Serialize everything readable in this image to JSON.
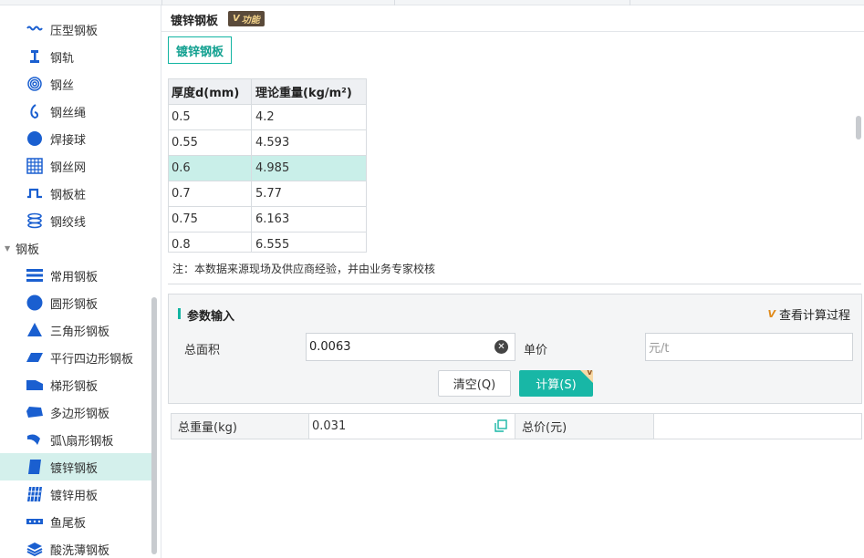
{
  "sidebar": {
    "items_top": [
      {
        "label": "压型钢板",
        "icon": "corrugated-wave-icon"
      },
      {
        "label": "钢轨",
        "icon": "rail-icon"
      },
      {
        "label": "钢丝",
        "icon": "wire-coil-icon"
      },
      {
        "label": "钢丝绳",
        "icon": "wire-rope-icon"
      },
      {
        "label": "焊接球",
        "icon": "ball-icon"
      },
      {
        "label": "钢丝网",
        "icon": "mesh-icon"
      },
      {
        "label": "钢板桩",
        "icon": "sheet-pile-icon"
      },
      {
        "label": "钢绞线",
        "icon": "strand-icon"
      }
    ],
    "group_label": "钢板",
    "items_group": [
      {
        "label": "常用钢板",
        "icon": "stacked-plates-icon"
      },
      {
        "label": "圆形钢板",
        "icon": "circle-plate-icon"
      },
      {
        "label": "三角形钢板",
        "icon": "triangle-plate-icon"
      },
      {
        "label": "平行四边形钢板",
        "icon": "parallelogram-plate-icon"
      },
      {
        "label": "梯形钢板",
        "icon": "trapezoid-plate-icon"
      },
      {
        "label": "多边形钢板",
        "icon": "polygon-plate-icon"
      },
      {
        "label": "弧\\扇形钢板",
        "icon": "sector-plate-icon"
      },
      {
        "label": "镀锌钢板",
        "icon": "galvanized-plate-icon"
      },
      {
        "label": "镀锌用板",
        "icon": "galvanized-grid-icon"
      },
      {
        "label": "鱼尾板",
        "icon": "fishplate-icon"
      },
      {
        "label": "酸洗薄钢板",
        "icon": "pickled-sheet-icon"
      }
    ],
    "active": "镀锌钢板"
  },
  "header": {
    "title": "镀锌钢板",
    "badge": "功能"
  },
  "tab": {
    "label": "镀锌钢板"
  },
  "table": {
    "headers": [
      "厚度d(mm)",
      "理论重量(kg/m²)"
    ],
    "rows": [
      [
        "0.5",
        "4.2"
      ],
      [
        "0.55",
        "4.593"
      ],
      [
        "0.6",
        "4.985"
      ],
      [
        "0.7",
        "5.77"
      ],
      [
        "0.75",
        "6.163"
      ],
      [
        "0.8",
        "6.555"
      ]
    ],
    "highlighted_row": 2
  },
  "note": "注：本数据来源现场及供应商经验，并由业务专家校核",
  "params": {
    "title": "参数输入",
    "view_process": "查看计算过程",
    "area_label": "总面积",
    "area_value": "0.0063",
    "price_label": "单价",
    "price_placeholder": "元/t",
    "clear_button": "清空(Q)",
    "calc_button": "计算(S)",
    "vip_mark": "V"
  },
  "result": {
    "weight_label": "总重量(kg)",
    "weight_value": "0.031",
    "price_label": "总价(元)",
    "price_value": ""
  },
  "colors": {
    "accent": "#18b7a6",
    "highlight_row": "#c9efe9",
    "active_sidebar": "#d4f0ec",
    "icon_blue": "#1a5fd0"
  }
}
